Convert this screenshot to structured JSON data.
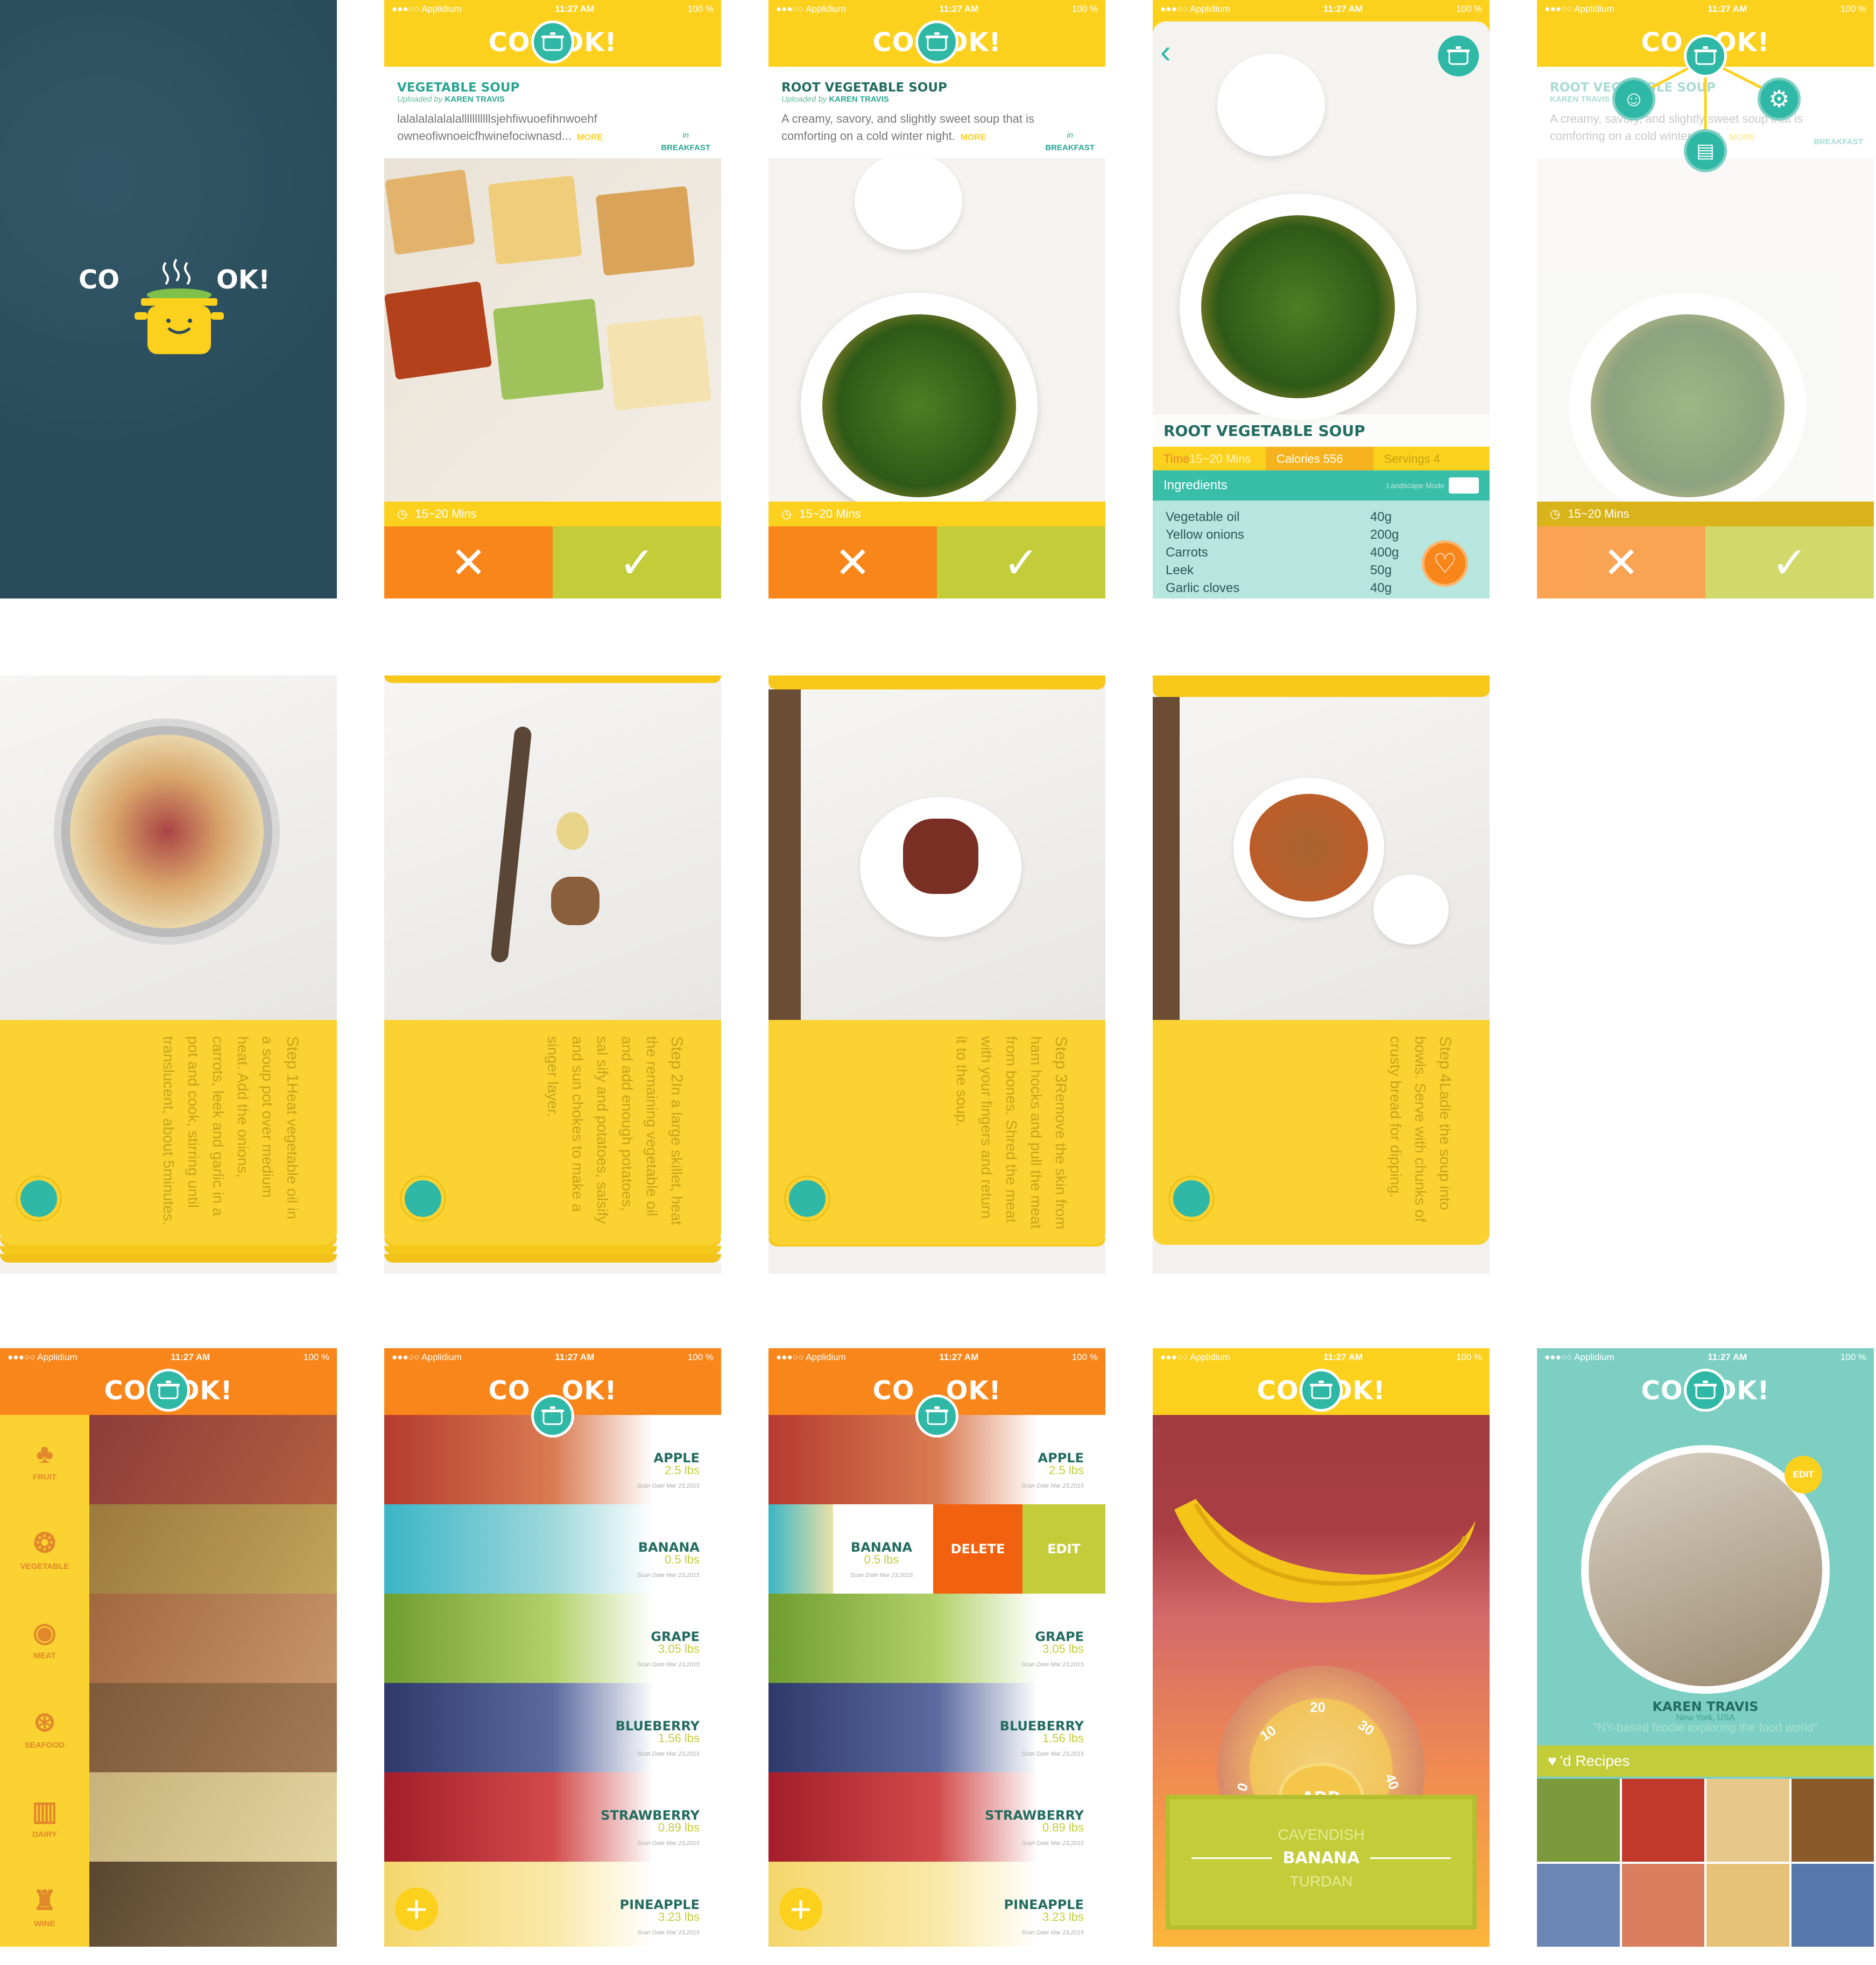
{
  "status_bar": {
    "carrier": "●●●○○ Applidium",
    "time": "11:27 AM",
    "battery": "100 %"
  },
  "logo": {
    "left": "CO",
    "right": "OK!"
  },
  "splash": {
    "logo_left": "CO",
    "logo_right": "OK!"
  },
  "card1": {
    "title": "VEGETABLE SOUP",
    "uploaded_by": "Uploaded by",
    "author": "KAREN TRAVIS",
    "in": "in",
    "category": "BREAKFAST",
    "description": "lalalalalalalalllllllllllsjehfiwuoefihnwoehf owneofiwnoeicfhwinefociwnasd...",
    "more": "MORE",
    "time": "15~20 Mins"
  },
  "card2": {
    "title": "ROOT VEGETABLE SOUP",
    "uploaded_by": "Uploaded by",
    "author": "KAREN TRAVIS",
    "in": "in",
    "category": "BREAKFAST",
    "description": "A creamy, savory, and slightly sweet soup that is comforting on a cold winter night.",
    "more": "MORE",
    "time": "15~20 Mins"
  },
  "detail": {
    "title": "ROOT VEGETABLE SOUP",
    "time_label": "Time",
    "time": "15~20 Mins",
    "cal_label": "Calories",
    "cal": "556",
    "serv_label": "Servings",
    "serv": "4",
    "ingredients_label": "Ingredients",
    "landscape": "Landscape Mode",
    "ingredients": [
      [
        "Vegetable oil",
        "40g"
      ],
      [
        "Yellow onions",
        "200g"
      ],
      [
        "Carrots",
        "400g"
      ],
      [
        "Leek",
        "50g"
      ],
      [
        "Garlic cloves",
        "40g"
      ]
    ]
  },
  "card_menu": {
    "title": "ROOT VEGETABLE SOUP",
    "author": "KAREN TRAVIS",
    "category": "BREAKFAST",
    "description": "A creamy, savory, and slightly sweet soup that is comforting on a cold winter night.",
    "more": "MORE",
    "time": "15~20 Mins"
  },
  "steps": [
    {
      "label": "Step 1",
      "text": "Heat vegetable oil in a soup pot over medium heat. Add the onions, carrots, leek and garlic in a pot and cook, stirring until translucent, about 5minutes."
    },
    {
      "label": "Step 2",
      "text": "In a large skillet, heat the remaining vegetable oil and add enough potatoes, sal sify and potatoes, salsify and sun chokes to make a singer layer."
    },
    {
      "label": "Step 3",
      "text": "Remove the skin from ham hocks and pull the meat from bones. Shred the meat with your fingers and return it to the soup."
    },
    {
      "label": "Step 4",
      "text": "Ladle the soup into bowls. Serve with chunks of crusty bread for dipping."
    }
  ],
  "categories": [
    "FRUIT",
    "VEGETABLE",
    "MEAT",
    "SEAFOOD",
    "DAIRY",
    "WINE"
  ],
  "fruits": [
    {
      "name": "APPLE",
      "weight": "2.5 lbs",
      "date": "Scan Date Mar 23,2015"
    },
    {
      "name": "BANANA",
      "weight": "0.5 lbs",
      "date": "Scan Date Mar 23,2015"
    },
    {
      "name": "GRAPE",
      "weight": "3.05 lbs",
      "date": "Scan Date Mar 23,2015"
    },
    {
      "name": "BLUEBERRY",
      "weight": "1.56 lbs",
      "date": "Scan Date Mar 23,2015"
    },
    {
      "name": "STRAWBERRY",
      "weight": "0.89 lbs",
      "date": "Scan Date Mar 23,2015"
    },
    {
      "name": "PINEAPPLE",
      "weight": "3.23 lbs",
      "date": "Scan Date Mar 23,2015"
    }
  ],
  "swipe": {
    "delete": "DELETE",
    "edit": "EDIT"
  },
  "add": {
    "button": "ADD",
    "dial": [
      "0",
      "10",
      "20",
      "30",
      "40"
    ],
    "options": [
      "CAVENDISH",
      "BANANA",
      "TURDAN"
    ]
  },
  "profile": {
    "edit": "EDIT",
    "name": "KAREN TRAVIS",
    "location": "New York, USA",
    "bio": "\"NY-based foodie exploring the food world\"",
    "liked": "'d Recipes"
  },
  "colors": {
    "yellow": "#fcd11e",
    "orange": "#f8861a",
    "green": "#c3cd3a",
    "teal": "#2fb8a6",
    "splash": "#2a4c5a"
  }
}
